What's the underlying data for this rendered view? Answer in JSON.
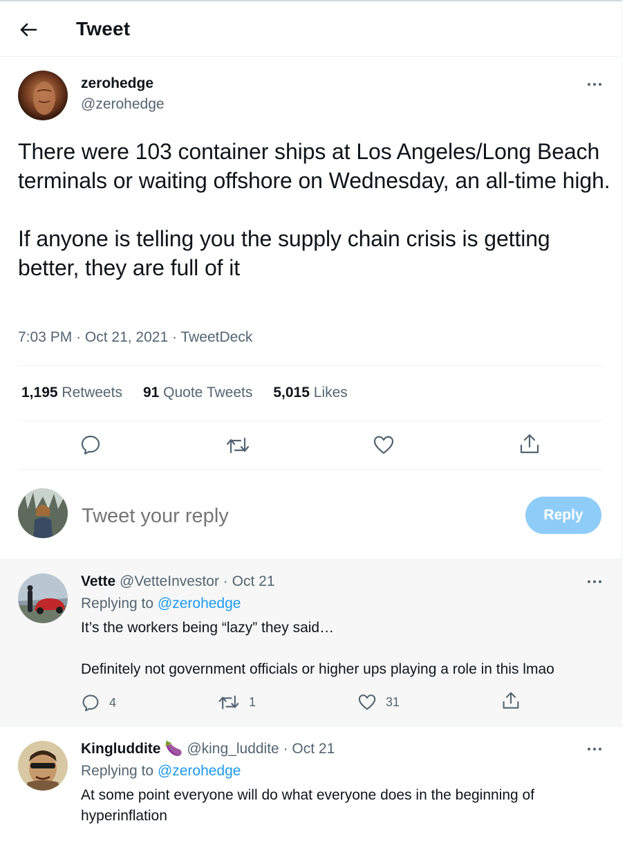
{
  "header": {
    "title": "Tweet",
    "back_icon": "arrow-left-icon"
  },
  "tweet": {
    "author_name": "zerohedge",
    "author_handle": "@zerohedge",
    "text": "There were 103 container ships at Los Angeles/Long Beach terminals or waiting offshore on Wednesday, an all-time high.\n\nIf anyone is telling you the supply chain crisis is getting better, they are full of it",
    "time": "7:03 PM",
    "separator": "·",
    "date": "Oct 21, 2021",
    "source": "TweetDeck",
    "stats": {
      "retweets_count": "1,195",
      "retweets_label": "Retweets",
      "quotes_count": "91",
      "quotes_label": "Quote Tweets",
      "likes_count": "5,015",
      "likes_label": "Likes"
    }
  },
  "composer": {
    "placeholder": "Tweet your reply",
    "button_label": "Reply"
  },
  "replies": [
    {
      "name": "Vette",
      "handle": "@VetteInvestor",
      "date": "Oct 21",
      "replying_prefix": "Replying to",
      "replying_to": "@zerohedge",
      "text": "It’s the workers being “lazy” they said…\n\nDefinitely not government officials or higher ups playing a role in this lmao",
      "reply_count": "4",
      "retweet_count": "1",
      "like_count": "31"
    },
    {
      "name": "Kingluddite",
      "name_emoji": "🍆",
      "handle": "@king_luddite",
      "date": "Oct 21",
      "replying_prefix": "Replying to",
      "replying_to": "@zerohedge",
      "text": "At some point everyone will do what everyone does in the beginning of hyperinflation"
    }
  ],
  "colors": {
    "accent": "#1d9bf0",
    "reply_button": "#8ecdf8",
    "secondary_text": "#536471",
    "divider": "#eff3f4"
  }
}
